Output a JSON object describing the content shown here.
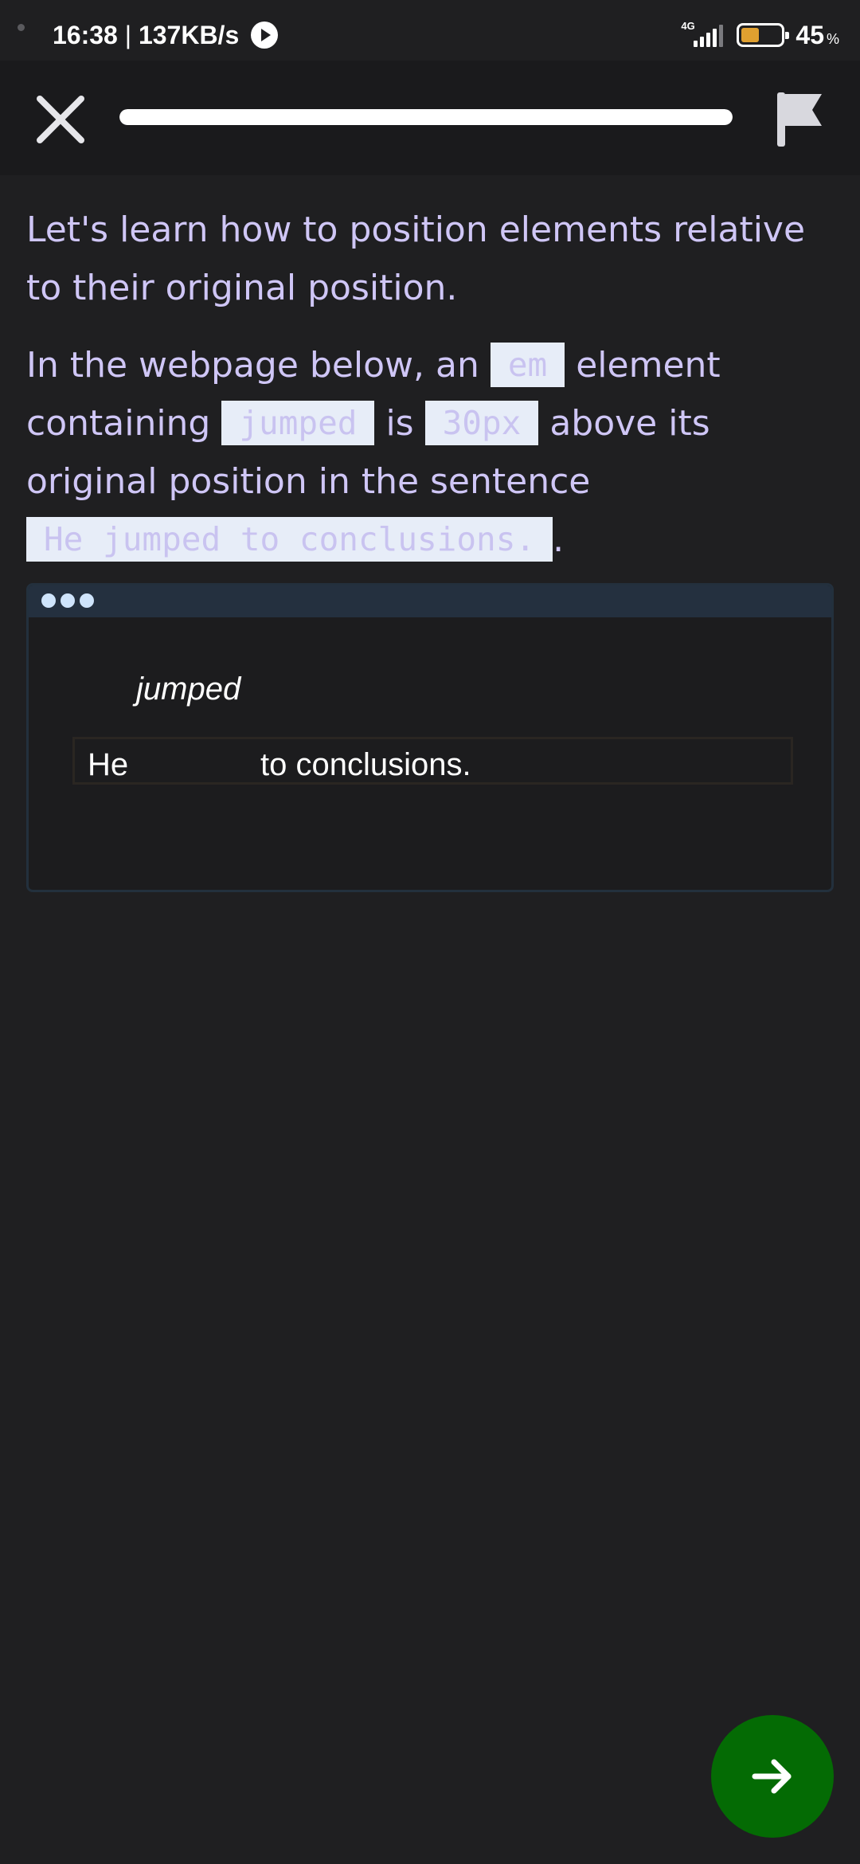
{
  "status_bar": {
    "time": "16:38",
    "separator": " | ",
    "speed": "137KB/s",
    "network_label": "4G",
    "battery_percent": "45",
    "battery_unit": "%",
    "battery_level": 0.45
  },
  "top_bar": {
    "close_icon": "close-icon",
    "flag_icon": "flag-icon",
    "progress": 1.0
  },
  "lesson": {
    "intro": "Let's learn how to position elements relative to their original position.",
    "p2_part1": "In the webpage below, an ",
    "p2_code1": "em",
    "p2_part2": " element containing ",
    "p2_code2": "jumped",
    "p2_part3": " is ",
    "p2_code3": "30px",
    "p2_part4": " above its original position in the sentence ",
    "p2_code4": "He jumped to conclusions.",
    "p2_part5": "."
  },
  "preview": {
    "em_text": "jumped",
    "sentence_start": "He",
    "sentence_end": "to conclusions."
  },
  "next_button": {
    "icon": "arrow-right-icon"
  },
  "colors": {
    "background": "#1f1f21",
    "lesson_text": "#cfc6f6",
    "code_bg": "#e7edf8",
    "browser_bar": "#24303f",
    "next_button": "#046b04",
    "battery_fill": "#e0a030"
  }
}
